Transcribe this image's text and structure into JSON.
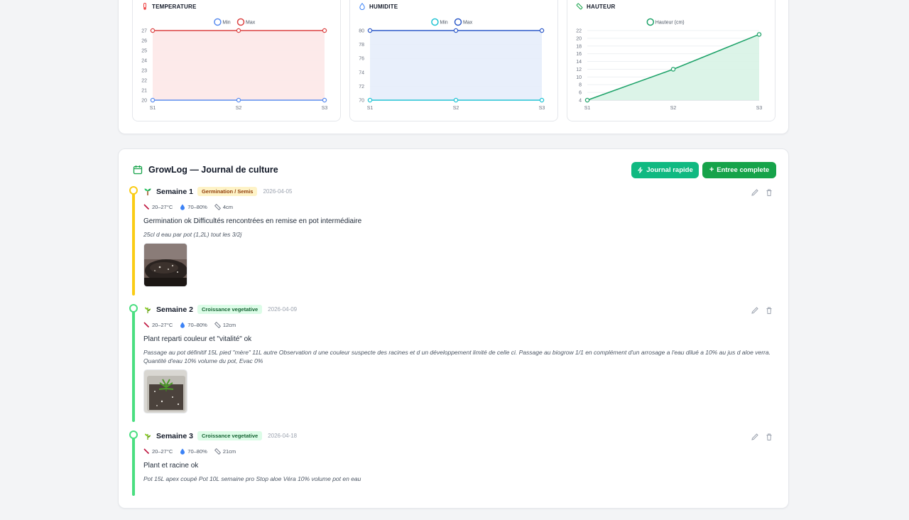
{
  "charts": [
    {
      "title": "TEMPERATURE",
      "icon": "thermometer-icon",
      "color": "#ef4444",
      "chart_data": {
        "type": "line",
        "x": [
          "S1",
          "S2",
          "S3"
        ],
        "ylim": [
          20,
          27
        ],
        "yticks": [
          20,
          21,
          22,
          23,
          24,
          25,
          26,
          27
        ],
        "grid": true,
        "legend": "top-center",
        "series": [
          {
            "name": "Min",
            "values": [
              20,
              20,
              20
            ],
            "color": "#5b8def"
          },
          {
            "name": "Max",
            "values": [
              27,
              27,
              27
            ],
            "color": "#dc4444"
          }
        ],
        "fill": {
          "from": "Min",
          "to": "Max",
          "color": "#fde8e8"
        }
      }
    },
    {
      "title": "HUMIDITE",
      "icon": "droplet-icon",
      "color": "#3b82f6",
      "chart_data": {
        "type": "line",
        "x": [
          "S1",
          "S2",
          "S3"
        ],
        "ylim": [
          70,
          80
        ],
        "yticks": [
          70,
          72,
          74,
          76,
          78,
          80
        ],
        "grid": true,
        "legend": "top-center",
        "series": [
          {
            "name": "Min",
            "values": [
              70,
              70,
              70
            ],
            "color": "#22c4d4"
          },
          {
            "name": "Max",
            "values": [
              80,
              80,
              80
            ],
            "color": "#2f5bc9"
          }
        ],
        "fill": {
          "from": "Min",
          "to": "Max",
          "color": "#e6edfb"
        }
      }
    },
    {
      "title": "HAUTEUR",
      "icon": "ruler-icon",
      "color": "#16a34a",
      "chart_data": {
        "type": "area",
        "x": [
          "S1",
          "S2",
          "S3"
        ],
        "ylim": [
          4,
          22
        ],
        "yticks": [
          4,
          6,
          8,
          10,
          12,
          14,
          16,
          18,
          20,
          22
        ],
        "grid": true,
        "legend": "top-center",
        "series": [
          {
            "name": "Hauteur (cm)",
            "values": [
              4,
              12,
              21
            ],
            "color": "#1fa36a"
          }
        ],
        "fill": {
          "from": "axis",
          "to": "Hauteur (cm)",
          "color": "#d8f3e5"
        }
      }
    }
  ],
  "growlog": {
    "title": "GrowLog — Journal de culture",
    "quick_label": "Journal rapide",
    "full_label": "Entree complete",
    "entries": [
      {
        "icon": "sprout-icon",
        "week": "Semaine 1",
        "stage": "Germination / Semis",
        "stage_bg": "#fef3c7",
        "stage_fg": "#92400e",
        "line_color": "#facc15",
        "date": "2026-04-05",
        "temp": "20–27°C",
        "humidity": "70–80%",
        "height": "4cm",
        "main": "Germination ok Difficultés rencontrées en remise en pot intermédiaire",
        "note": "25cl d eau par pot (1,2L) tout les 3/2j"
      },
      {
        "icon": "plant-icon",
        "week": "Semaine 2",
        "stage": "Croissance vegetative",
        "stage_bg": "#dcfce7",
        "stage_fg": "#166534",
        "line_color": "#4ade80",
        "date": "2026-04-09",
        "temp": "20–27°C",
        "humidity": "70–80%",
        "height": "12cm",
        "main": "Plant reparti couleur et \"vitalité\" ok",
        "note": "Passage au pot définitif 15L pied \"mère\" 11L autre Observation d une couleur suspecte des racines et d un développement limité de celle ci. Passage au biogrow 1/1 en complément d'un arrosage a l'eau dilué a 10% au jus d aloe verra. Quantité d'eau 10% volume du pot, Evac 0%"
      },
      {
        "icon": "plant-icon",
        "week": "Semaine 3",
        "stage": "Croissance vegetative",
        "stage_bg": "#dcfce7",
        "stage_fg": "#166534",
        "line_color": "#4ade80",
        "date": "2026-04-18",
        "temp": "20–27°C",
        "humidity": "70–80%",
        "height": "21cm",
        "main": "Plant et racine ok",
        "note": "Pot 15L apex coupé Pot 10L semaine pro Stop aloe Véra 10% volume pot en eau"
      }
    ]
  }
}
